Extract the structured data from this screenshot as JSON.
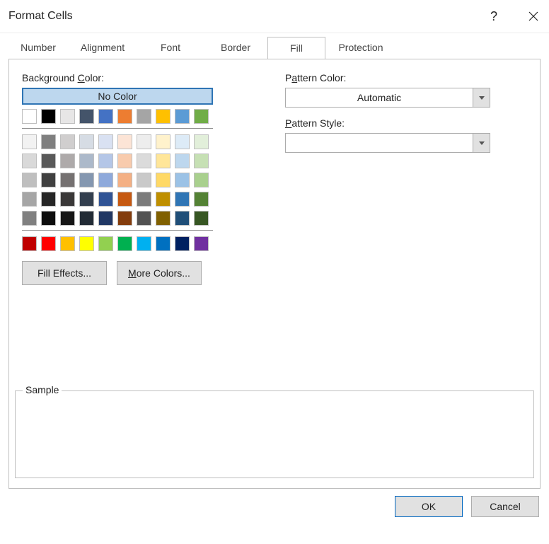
{
  "title": "Format Cells",
  "tabs": [
    "Number",
    "Alignment",
    "Font",
    "Border",
    "Fill",
    "Protection"
  ],
  "activeTab": "Fill",
  "labels": {
    "bgColorPrefix": "Background ",
    "bgColorHot": "C",
    "bgColorSuffix": "olor:",
    "noColor": "No Color",
    "patternColorPrefix": "P",
    "patternColorHot": "a",
    "patternColorSuffix": "ttern Color:",
    "patternStyleHot": "P",
    "patternStyleSuffix": "attern Style:",
    "fillEffectsHot": "Fill",
    "fillEffectsSuffix": " Effects...",
    "moreColorsHot": "M",
    "moreColorsSuffix": "ore Colors...",
    "sample": "Sample"
  },
  "patternColorValue": "Automatic",
  "patternStyleValue": "",
  "colors": {
    "r1": [
      "#ffffff",
      "#000000",
      "#e7e6e6",
      "#44546a",
      "#4472c4",
      "#ed7d31",
      "#a5a5a5",
      "#ffc000",
      "#5b9bd5",
      "#70ad47"
    ],
    "r2": [
      "#f2f2f2",
      "#7f7f7f",
      "#d0cece",
      "#d6dce4",
      "#d9e1f2",
      "#fce4d6",
      "#ededed",
      "#fff2cc",
      "#ddebf7",
      "#e2efda"
    ],
    "r3": [
      "#d9d9d9",
      "#595959",
      "#aeaaaa",
      "#acb9ca",
      "#b4c6e7",
      "#f8cbad",
      "#dbdbdb",
      "#ffe699",
      "#bdd7ee",
      "#c6e0b4"
    ],
    "r4": [
      "#bfbfbf",
      "#404040",
      "#757171",
      "#8497b0",
      "#8ea9db",
      "#f4b084",
      "#c9c9c9",
      "#ffd966",
      "#9bc2e6",
      "#a9d08e"
    ],
    "r5": [
      "#a6a6a6",
      "#262626",
      "#3a3838",
      "#333f4f",
      "#305496",
      "#c65911",
      "#7b7b7b",
      "#bf8f00",
      "#2f75b5",
      "#548235"
    ],
    "r6": [
      "#808080",
      "#0d0d0d",
      "#161616",
      "#222b35",
      "#203764",
      "#833c0c",
      "#525252",
      "#806000",
      "#1f4e78",
      "#375623"
    ],
    "std": [
      "#c00000",
      "#ff0000",
      "#ffc000",
      "#ffff00",
      "#92d050",
      "#00b050",
      "#00b0f0",
      "#0070c0",
      "#002060",
      "#7030a0"
    ]
  },
  "buttons": {
    "ok": "OK",
    "cancel": "Cancel"
  }
}
